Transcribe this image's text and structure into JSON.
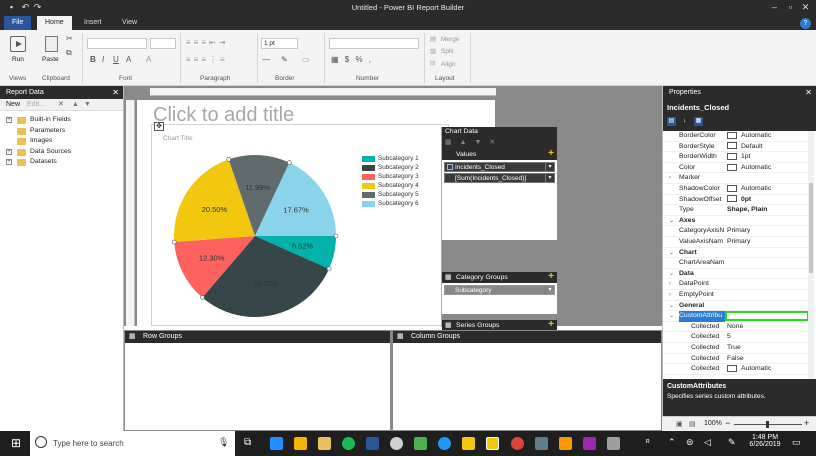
{
  "window": {
    "title": "Untitled - Power BI Report Builder"
  },
  "tabs": [
    {
      "label": "File"
    },
    {
      "label": "Home"
    },
    {
      "label": "Insert"
    },
    {
      "label": "View"
    }
  ],
  "ribbon": {
    "run_label": "Run",
    "paste_label": "Paste",
    "border_width": "1 pt",
    "merge_label": "Merge",
    "split_label": "Split",
    "align_label": "Align",
    "groups": [
      "Views",
      "Clipboard",
      "Font",
      "Paragraph",
      "Border",
      "Number",
      "Layout"
    ]
  },
  "report_data": {
    "title": "Report Data",
    "new_label": "New",
    "edit_label": "Edit...",
    "items": [
      {
        "label": "Built-in Fields",
        "expandable": true
      },
      {
        "label": "Parameters",
        "expandable": false
      },
      {
        "label": "Images",
        "expandable": false
      },
      {
        "label": "Data Sources",
        "expandable": true
      },
      {
        "label": "Datasets",
        "expandable": true
      }
    ]
  },
  "design": {
    "title_placeholder": "Click to add title",
    "chart_title": "Chart Title"
  },
  "chart_data": {
    "type": "pie",
    "title": "Chart Title",
    "categories": [
      "Subcategory 1",
      "Subcategory 2",
      "Subcategory 3",
      "Subcategory 4",
      "Subcategory 5",
      "Subcategory 6"
    ],
    "values": [
      6.52,
      29.02,
      12.3,
      20.5,
      11.99,
      17.67
    ],
    "data_labels": [
      "6.52%",
      "29.02%",
      "12.30%",
      "20.50%",
      "11.99%",
      "17.67%"
    ],
    "colors": [
      "#00b2a9",
      "#374649",
      "#fd625e",
      "#f2c80f",
      "#5f6b6d",
      "#8ad4eb"
    ],
    "legend_position": "right"
  },
  "chart_data_panel": {
    "title": "Chart Data",
    "values_label": "Values",
    "values_items": [
      "Incidents_Closed",
      "[Sum(Incidents_Closed)]"
    ],
    "category_groups_label": "Category Groups",
    "category_item": "Subcategory",
    "series_groups_label": "Series Groups"
  },
  "groups": {
    "row_label": "Row Groups",
    "column_label": "Column Groups"
  },
  "properties": {
    "title": "Properties",
    "selected": "Incidents_Closed",
    "rows": [
      {
        "k": "BorderColor",
        "v": "Automatic",
        "swatch": true
      },
      {
        "k": "BorderStyle",
        "v": "Default",
        "swatch": true
      },
      {
        "k": "BorderWidth",
        "v": "1pt",
        "swatch": true
      },
      {
        "k": "Color",
        "v": "Automatic",
        "swatch": true
      },
      {
        "k": "Marker",
        "v": "",
        "expand": true
      },
      {
        "k": "ShadowColor",
        "v": "Automatic",
        "swatch": true
      },
      {
        "k": "ShadowOffset",
        "v": "0pt",
        "swatch": true,
        "bold": true
      },
      {
        "k": "Type",
        "v": "Shape, Plain",
        "bold": true
      },
      {
        "k": "Axes",
        "cat": true
      },
      {
        "k": "CategoryAxisN",
        "v": "Primary"
      },
      {
        "k": "ValueAxisNam",
        "v": "Primary"
      },
      {
        "k": "Chart",
        "cat": true
      },
      {
        "k": "ChartAreaNam",
        "v": ""
      },
      {
        "k": "Data",
        "cat": true
      },
      {
        "k": "DataPoint",
        "v": "",
        "expand": true
      },
      {
        "k": "EmptyPoint",
        "v": "",
        "expand": true
      },
      {
        "k": "General",
        "cat": true
      },
      {
        "k": "CustomAttribu",
        "v": "",
        "selected": true
      },
      {
        "k": "Collected",
        "v": "None",
        "indent": true
      },
      {
        "k": "Collected",
        "v": "5",
        "indent": true
      },
      {
        "k": "Collected",
        "v": "True",
        "indent": true
      },
      {
        "k": "Collected",
        "v": "False",
        "indent": true
      },
      {
        "k": "Collected",
        "v": "Automatic",
        "indent": true,
        "swatch": true
      }
    ],
    "desc_title": "CustomAttributes",
    "desc_text": "Specifies series custom attributes."
  },
  "status": {
    "zoom": "100%"
  },
  "taskbar": {
    "search_placeholder": "Type here to search",
    "time": "1:48 PM",
    "date": "6/26/2019"
  }
}
